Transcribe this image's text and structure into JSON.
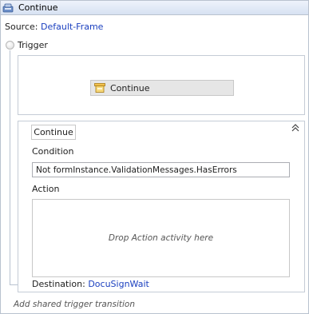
{
  "state": {
    "title": "Continue",
    "icon": "state-icon"
  },
  "source": {
    "label": "Source:",
    "value": "Default-Frame"
  },
  "trigger": {
    "label": "Trigger",
    "activity_label": "Continue",
    "activity_icon": "activity-icon"
  },
  "transition": {
    "name": "Continue",
    "condition_label": "Condition",
    "condition_value": "Not formInstance.ValidationMessages.HasErrors",
    "action_label": "Action",
    "action_placeholder": "Drop Action activity here",
    "destination_label": "Destination:",
    "destination_value": "DocuSignWait"
  },
  "footer": {
    "add_shared_trigger": "Add shared trigger transition"
  },
  "colors": {
    "link": "#1a3fbf",
    "border": "#b9c2cf",
    "header_top": "#eef3fb",
    "header_bottom": "#d7e2f2"
  }
}
